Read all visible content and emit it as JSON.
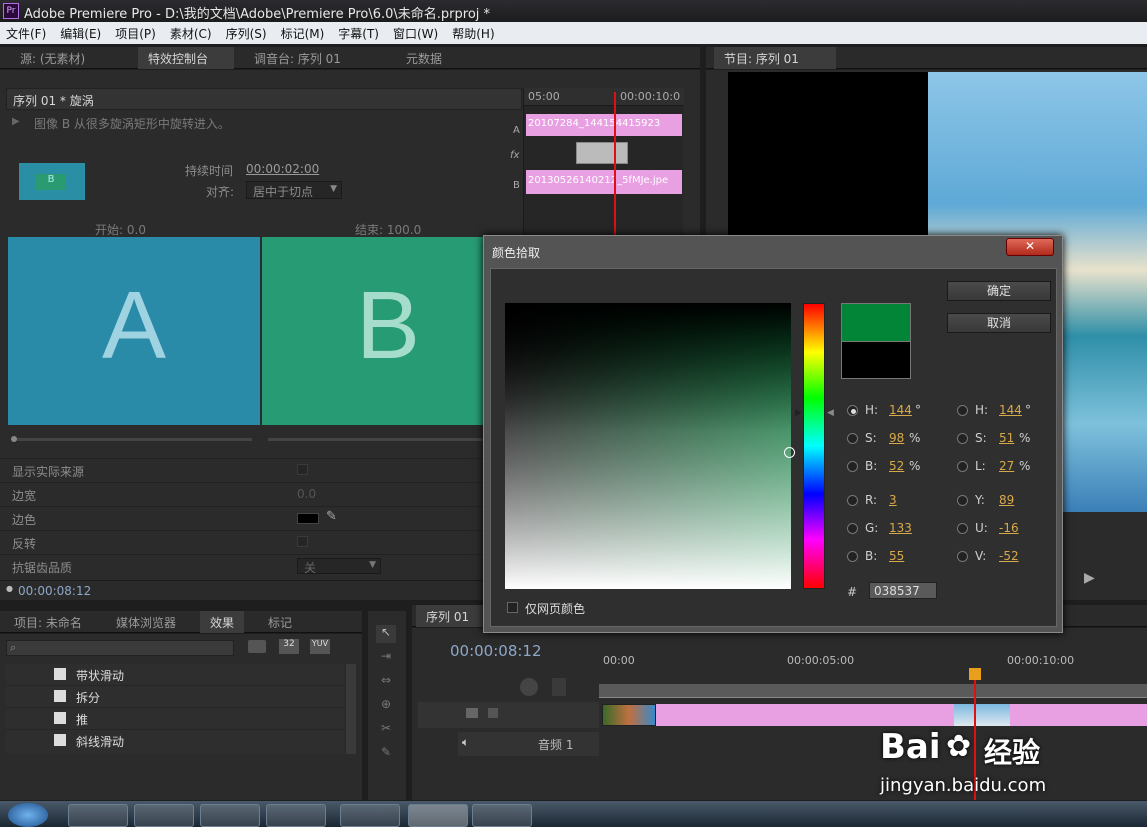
{
  "window": {
    "title": "Adobe Premiere Pro - D:\\我的文档\\Adobe\\Premiere Pro\\6.0\\未命名.prproj *",
    "app_icon": "Pr"
  },
  "menu": [
    "文件(F)",
    "编辑(E)",
    "项目(P)",
    "素材(C)",
    "序列(S)",
    "标记(M)",
    "字幕(T)",
    "窗口(W)",
    "帮助(H)"
  ],
  "left_tabs": [
    "源: (无素材)",
    "特效控制台",
    "调音台: 序列 01",
    "元数据"
  ],
  "right_tabs": [
    "节目: 序列 01"
  ],
  "effect_controls": {
    "header": "序列 01 * 旋涡",
    "description": "图像 B 从很多旋涡矩形中旋转进入。",
    "duration_label": "持续时间",
    "duration_value": "00:00:02:00",
    "align_label": "对齐:",
    "align_value": "居中于切点",
    "start_label": "开始:",
    "start_value": "0.0",
    "end_label": "结束:",
    "end_value": "100.0",
    "thumb_letter": "B",
    "a_letter": "A",
    "b_letter": "B",
    "props": [
      {
        "label": "显示实际来源",
        "value": ""
      },
      {
        "label": "边宽",
        "value": "0.0"
      },
      {
        "label": "边色",
        "value": ""
      },
      {
        "label": "反转",
        "value": ""
      },
      {
        "label": "抗锯齿品质",
        "value": "关"
      }
    ],
    "timecode": "00:00:08:12",
    "mini_ruler": {
      "start": "05:00",
      "end": "00:00:10:0"
    },
    "mini_tracks": {
      "a_label": "A",
      "fx_label": "fx",
      "b_label": "B",
      "a_clip": "20107284_144154415923",
      "b_clip": "20130526140212_5fMJe.jpe"
    }
  },
  "color_picker": {
    "title": "颜色拾取",
    "ok": "确定",
    "cancel": "取消",
    "web_only": "仅网页颜色",
    "hex_label": "#",
    "hex_value": "038537",
    "left_fields": [
      {
        "label": "H:",
        "value": "144",
        "unit": "°",
        "selected": true
      },
      {
        "label": "S:",
        "value": "98",
        "unit": "%",
        "selected": false
      },
      {
        "label": "B:",
        "value": "52",
        "unit": "%",
        "selected": false
      },
      {
        "label": "R:",
        "value": "3",
        "unit": "",
        "selected": false
      },
      {
        "label": "G:",
        "value": "133",
        "unit": "",
        "selected": false
      },
      {
        "label": "B:",
        "value": "55",
        "unit": "",
        "selected": false
      }
    ],
    "right_fields": [
      {
        "label": "H:",
        "value": "144",
        "unit": "°"
      },
      {
        "label": "S:",
        "value": "51",
        "unit": "%"
      },
      {
        "label": "L:",
        "value": "27",
        "unit": "%"
      },
      {
        "label": "Y:",
        "value": "89",
        "unit": ""
      },
      {
        "label": "U:",
        "value": "-16",
        "unit": ""
      },
      {
        "label": "V:",
        "value": "-52",
        "unit": ""
      }
    ],
    "new_color": "#038537",
    "old_color": "#000000"
  },
  "project_panel": {
    "tabs": [
      "项目: 未命名",
      "媒体浏览器",
      "效果",
      "标记"
    ],
    "badge_32": "32",
    "badge_yuv": "YUV",
    "items": [
      "带状滑动",
      "拆分",
      "推",
      "斜线滑动"
    ]
  },
  "timeline": {
    "tab": "序列 01",
    "timecode": "00:00:08:12",
    "ruler": [
      "00:00",
      "00:00:05:00",
      "00:00:10:00"
    ],
    "audio_track": "音频 1"
  },
  "watermark": {
    "brand": "Bai",
    "brand2": "经验",
    "url": "jingyan.baidu.com"
  },
  "colors": {
    "accent": "#d8a94a",
    "clip_pink": "#e9a0e3",
    "teal_a": "#2e8fa6",
    "green_b": "#2a9a72"
  }
}
